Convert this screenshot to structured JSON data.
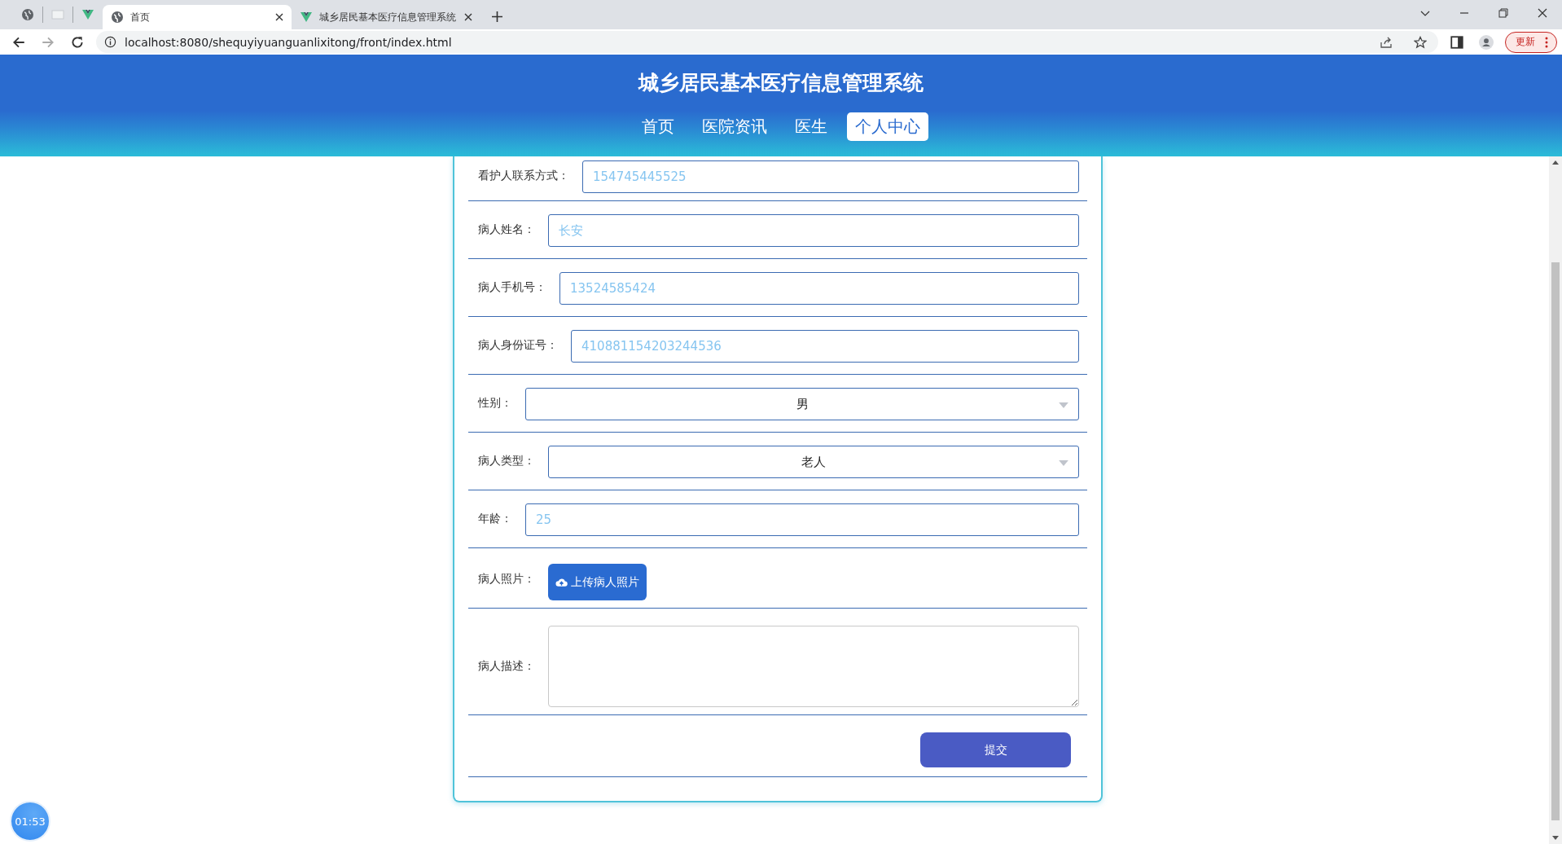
{
  "browser": {
    "tabs": [
      {
        "title": "首页",
        "selected": true
      },
      {
        "title": "城乡居民基本医疗信息管理系统",
        "selected": false
      }
    ],
    "url": "localhost:8080/shequyiyuanguanlixitong/front/index.html",
    "update_button": "更新"
  },
  "header": {
    "title": "城乡居民基本医疗信息管理系统",
    "nav": [
      {
        "label": "首页",
        "selected": false
      },
      {
        "label": "医院资讯",
        "selected": false
      },
      {
        "label": "医生",
        "selected": false
      },
      {
        "label": "个人中心",
        "selected": true
      }
    ]
  },
  "form": {
    "fields": [
      {
        "kind": "input",
        "label": "看护人联系方式：",
        "value": "154745445525"
      },
      {
        "kind": "input",
        "label": "病人姓名：",
        "value": "长安"
      },
      {
        "kind": "input",
        "label": "病人手机号：",
        "value": "13524585424"
      },
      {
        "kind": "input",
        "label": "病人身份证号：",
        "value": "410881154203244536"
      },
      {
        "kind": "select",
        "label": "性别：",
        "value": "男"
      },
      {
        "kind": "select",
        "label": "病人类型：",
        "value": "老人"
      },
      {
        "kind": "input",
        "label": "年龄：",
        "value": "25"
      },
      {
        "kind": "upload",
        "label": "病人照片：",
        "value": "上传病人照片"
      },
      {
        "kind": "textarea",
        "label": "病人描述："
      }
    ],
    "submit": "提交"
  },
  "timer": "01:53"
}
